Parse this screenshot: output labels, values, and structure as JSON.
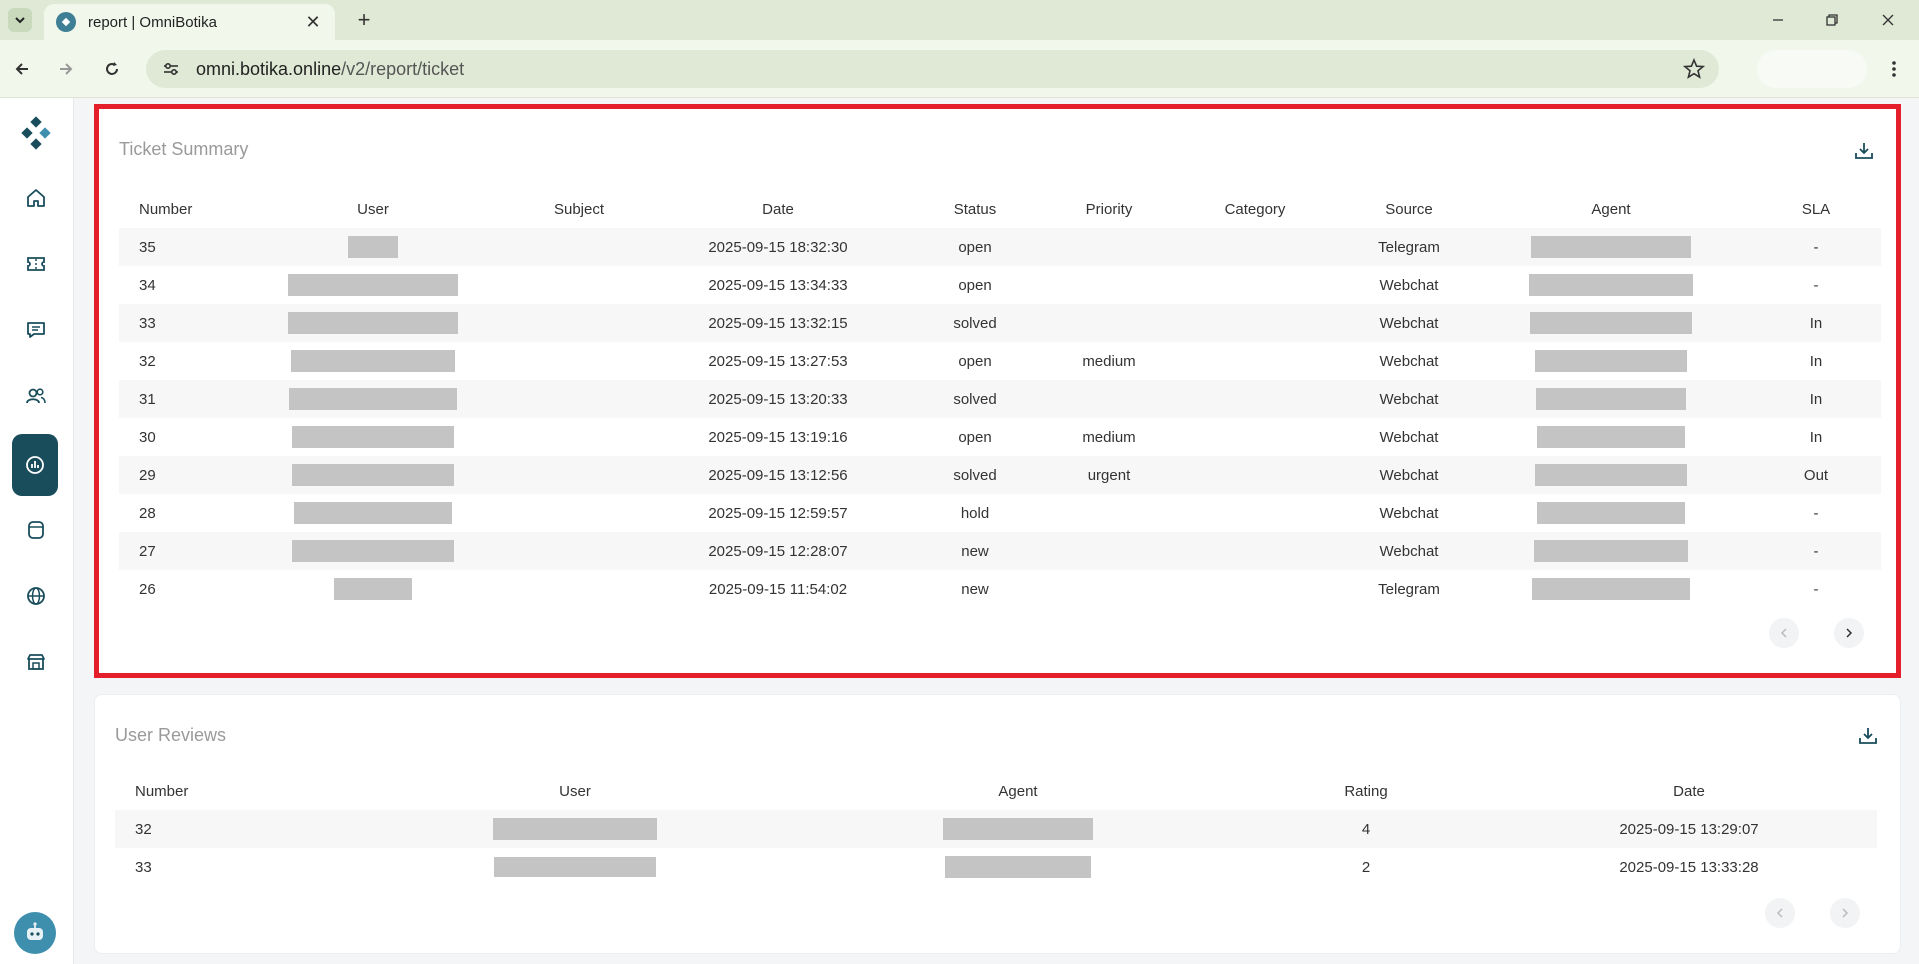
{
  "browser": {
    "tab_title": "report | OmniBotika",
    "url_host": "omni.botika.online",
    "url_path": "/v2/report/ticket"
  },
  "colors": {
    "sidebar_active": "#194d5c",
    "highlight_border": "#e41e2b",
    "title_gray": "#9a9a9a"
  },
  "sidebar": {
    "items": [
      {
        "icon": "home-icon"
      },
      {
        "icon": "ticket-icon"
      },
      {
        "icon": "chat-icon"
      },
      {
        "icon": "users-icon"
      },
      {
        "icon": "report-icon",
        "active": true
      },
      {
        "icon": "database-icon"
      },
      {
        "icon": "globe-icon"
      },
      {
        "icon": "store-icon"
      }
    ]
  },
  "ticket_summary": {
    "title": "Ticket Summary",
    "columns": [
      "Number",
      "User",
      "Subject",
      "Date",
      "Status",
      "Priority",
      "Category",
      "Source",
      "Agent",
      "SLA"
    ],
    "rows": [
      {
        "number": "35",
        "subject": "",
        "date": "2025-09-15 18:32:30",
        "status": "open",
        "priority": "",
        "category": "",
        "source": "Telegram",
        "sla": "-"
      },
      {
        "number": "34",
        "subject": "",
        "date": "2025-09-15 13:34:33",
        "status": "open",
        "priority": "",
        "category": "",
        "source": "Webchat",
        "sla": "-"
      },
      {
        "number": "33",
        "subject": "",
        "date": "2025-09-15 13:32:15",
        "status": "solved",
        "priority": "",
        "category": "",
        "source": "Webchat",
        "sla": "In"
      },
      {
        "number": "32",
        "subject": "",
        "date": "2025-09-15 13:27:53",
        "status": "open",
        "priority": "medium",
        "category": "",
        "source": "Webchat",
        "sla": "In"
      },
      {
        "number": "31",
        "subject": "",
        "date": "2025-09-15 13:20:33",
        "status": "solved",
        "priority": "",
        "category": "",
        "source": "Webchat",
        "sla": "In"
      },
      {
        "number": "30",
        "subject": "",
        "date": "2025-09-15 13:19:16",
        "status": "open",
        "priority": "medium",
        "category": "",
        "source": "Webchat",
        "sla": "In"
      },
      {
        "number": "29",
        "subject": "",
        "date": "2025-09-15 13:12:56",
        "status": "solved",
        "priority": "urgent",
        "category": "",
        "source": "Webchat",
        "sla": "Out"
      },
      {
        "number": "28",
        "subject": "",
        "date": "2025-09-15 12:59:57",
        "status": "hold",
        "priority": "",
        "category": "",
        "source": "Webchat",
        "sla": "-"
      },
      {
        "number": "27",
        "subject": "",
        "date": "2025-09-15 12:28:07",
        "status": "new",
        "priority": "",
        "category": "",
        "source": "Webchat",
        "sla": "-"
      },
      {
        "number": "26",
        "subject": "",
        "date": "2025-09-15 11:54:02",
        "status": "new",
        "priority": "",
        "category": "",
        "source": "Telegram",
        "sla": "-"
      }
    ]
  },
  "user_reviews": {
    "title": "User Reviews",
    "columns": [
      "Number",
      "User",
      "Agent",
      "Rating",
      "Date"
    ],
    "rows": [
      {
        "number": "32",
        "rating": "4",
        "date": "2025-09-15 13:29:07"
      },
      {
        "number": "33",
        "rating": "2",
        "date": "2025-09-15 13:33:28"
      }
    ]
  }
}
